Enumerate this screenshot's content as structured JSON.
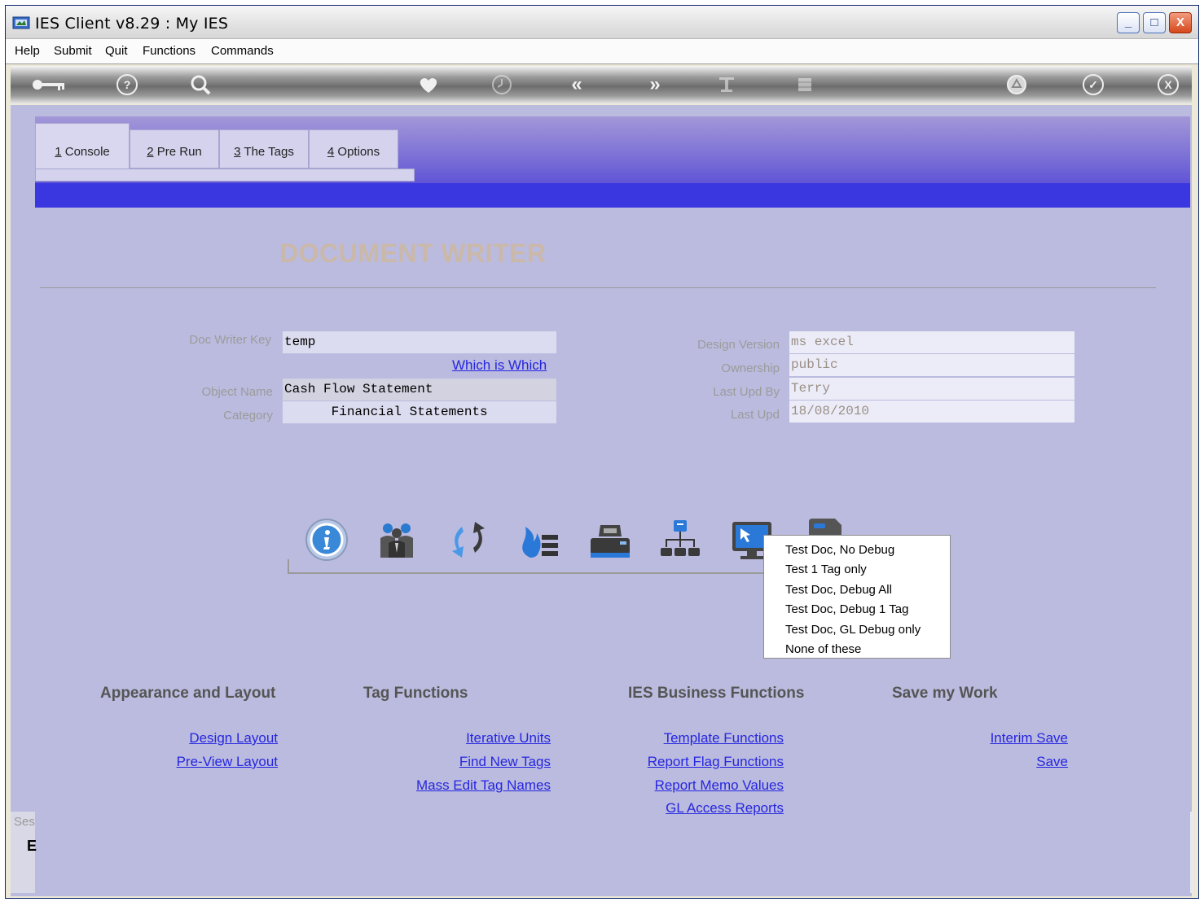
{
  "window": {
    "title": "IES Client v8.29 : My IES",
    "controls": {
      "minimize": "_",
      "maximize": "□",
      "close": "X"
    }
  },
  "menubar": [
    "Help",
    "Submit",
    "Quit",
    "Functions",
    "Commands"
  ],
  "toolbar": {
    "icons": [
      "key-icon",
      "help-icon",
      "search-icon",
      "heart-icon",
      "clock-icon",
      "back-icon",
      "forward-icon",
      "text-cursor-icon",
      "grid-icon",
      "recycle-icon",
      "check-icon",
      "close-icon"
    ],
    "glyphs": {
      "back": "«",
      "forward": "»",
      "help": "?",
      "check": "✓",
      "close": "X"
    }
  },
  "tabs": [
    {
      "num": "1",
      "label": "Console",
      "active": true
    },
    {
      "num": "2",
      "label": "Pre Run",
      "active": false
    },
    {
      "num": "3",
      "label": "The Tags",
      "active": false
    },
    {
      "num": "4",
      "label": "Options",
      "active": false
    }
  ],
  "page_title": "DOCUMENT WRITER",
  "form_left": {
    "doc_writer_key_label": "Doc Writer Key",
    "doc_writer_key_value": "temp",
    "which_is_which": "Which is Which",
    "object_name_label": "Object Name",
    "object_name_value": "Cash Flow Statement",
    "category_label": "Category",
    "category_value": "      Financial Statements"
  },
  "form_right": {
    "design_version_label": "Design Version",
    "design_version_value": "ms excel",
    "ownership_label": "Ownership",
    "ownership_value": "public",
    "last_upd_by_label": "Last Upd By",
    "last_upd_by_value": "Terry",
    "last_upd_label": "Last Upd",
    "last_upd_value": "18/08/2010"
  },
  "action_icons": [
    "info-icon",
    "people-icon",
    "refresh-icon",
    "fire-list-icon",
    "printer-icon",
    "hierarchy-icon",
    "monitor-icon",
    "document-icon"
  ],
  "popup_menu": [
    "Test Doc, No Debug",
    "Test 1 Tag only",
    "Test Doc, Debug All",
    "Test Doc, Debug 1 Tag",
    "Test Doc, GL Debug only",
    "None of these"
  ],
  "sections": {
    "appearance": {
      "title": "Appearance and Layout",
      "links": [
        "Design Layout",
        "Pre-View Layout"
      ]
    },
    "tag_functions": {
      "title": "Tag Functions",
      "links": [
        "Iterative Units",
        "Find New Tags",
        "Mass Edit Tag Names"
      ]
    },
    "business": {
      "title": "IES Business Functions",
      "links": [
        "Template Functions",
        "Report Flag Functions",
        "Report Memo Values",
        "GL Access Reports"
      ]
    },
    "save": {
      "title": "Save my Work",
      "links": [
        "Interim Save",
        "Save"
      ]
    }
  },
  "status": {
    "label": "Ses",
    "glyph": "E"
  },
  "colors": {
    "content_bg": "#bbbbdf",
    "header_blue": "#3b37e0",
    "link": "#2626e0",
    "title_tan": "#cab8a8"
  }
}
